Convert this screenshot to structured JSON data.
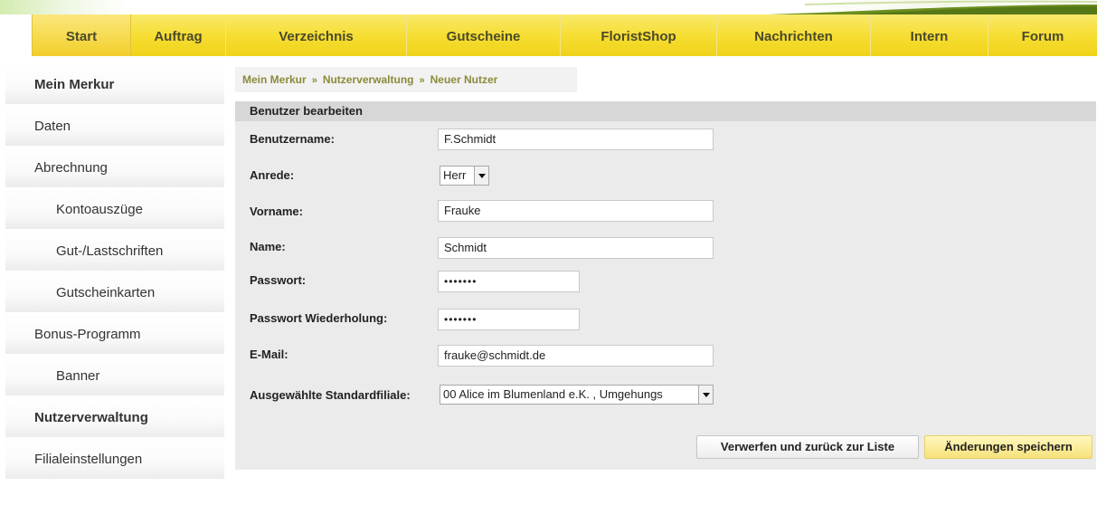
{
  "nav": {
    "items": [
      "Start",
      "Auftrag",
      "Verzeichnis",
      "Gutscheine",
      "FloristShop",
      "Nachrichten",
      "Intern",
      "Forum"
    ],
    "active": "Start"
  },
  "sidebar": {
    "items": [
      {
        "label": "Mein Merkur",
        "bold": true,
        "level": 0
      },
      {
        "label": "Daten",
        "bold": false,
        "level": 0
      },
      {
        "label": "Abrechnung",
        "bold": false,
        "level": 0
      },
      {
        "label": "Kontoauszüge",
        "bold": false,
        "level": 1
      },
      {
        "label": "Gut-/Lastschriften",
        "bold": false,
        "level": 1
      },
      {
        "label": "Gutscheinkarten",
        "bold": false,
        "level": 1
      },
      {
        "label": "Bonus-Programm",
        "bold": false,
        "level": 0
      },
      {
        "label": "Banner",
        "bold": false,
        "level": 1
      },
      {
        "label": "Nutzerverwaltung",
        "bold": true,
        "level": 0
      },
      {
        "label": "Filialeinstellungen",
        "bold": false,
        "level": 0
      }
    ]
  },
  "breadcrumb": {
    "items": [
      "Mein Merkur",
      "Nutzerverwaltung",
      "Neuer Nutzer"
    ],
    "separator": "»"
  },
  "form": {
    "title": "Benutzer bearbeiten",
    "username_label": "Benutzername:",
    "username_value": "F.Schmidt",
    "salutation_label": "Anrede:",
    "salutation_value": "Herr",
    "firstname_label": "Vorname:",
    "firstname_value": "Frauke",
    "lastname_label": "Name:",
    "lastname_value": "Schmidt",
    "password_label": "Passwort:",
    "password_value": "•••••••",
    "password_repeat_label": "Passwort Wiederholung:",
    "password_repeat_value": "•••••••",
    "email_label": "E-Mail:",
    "email_value": "frauke@schmidt.de",
    "branch_label": "Ausgewählte Standardfiliale:",
    "branch_value": "00 Alice im Blumenland e.K. , Umgehungs"
  },
  "buttons": {
    "discard": "Verwerfen und zurück zur Liste",
    "save": "Änderungen speichern"
  },
  "colors": {
    "nav_yellow": "#f6dd2f",
    "breadcrumb_text": "#8c8a3a",
    "save_button": "#f6e27a"
  }
}
